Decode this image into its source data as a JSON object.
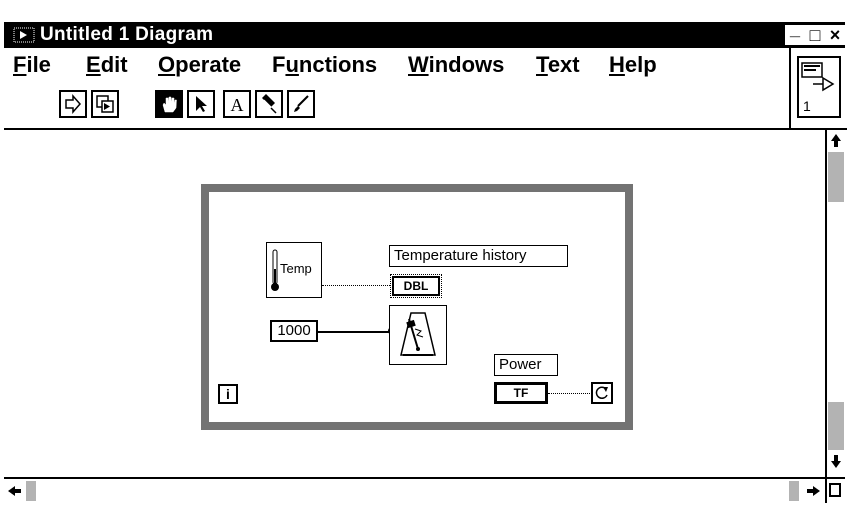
{
  "window": {
    "title": "Untitled 1 Diagram",
    "controls": {
      "minimize": "_",
      "maximize": "□",
      "close": "×"
    }
  },
  "menu": [
    {
      "label": "File"
    },
    {
      "label": "Edit"
    },
    {
      "label": "Operate"
    },
    {
      "label": "Functions"
    },
    {
      "label": "Windows"
    },
    {
      "label": "Text"
    },
    {
      "label": "Help"
    }
  ],
  "toolbar": {
    "tools": [
      "run-icon",
      "run-continuous-icon",
      "operate-hand-icon",
      "position-arrow-icon",
      "text-tool-icon",
      "wiring-spool-icon",
      "color-brush-icon"
    ],
    "selected": "operate-hand-icon"
  },
  "connector_panel": {
    "pane_number": "1"
  },
  "diagram": {
    "thermometer_label": "Temp",
    "indicator_label": "Temperature history",
    "indicator_type": "DBL",
    "wait_constant": "1000",
    "power_label": "Power",
    "power_type": "TF",
    "iteration_terminal": "i"
  },
  "colors": {
    "title_bar": "#000000",
    "background": "#ffffff",
    "text": "#000000"
  }
}
